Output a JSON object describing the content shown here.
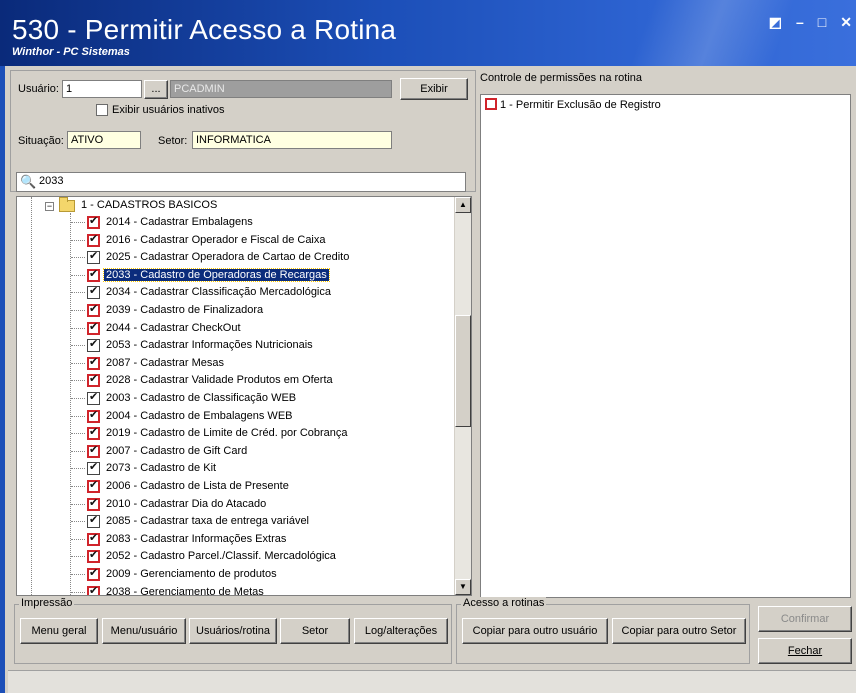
{
  "window": {
    "title": "530 - Permitir Acesso a Rotina",
    "subtitle": "Winthor - PC Sistemas",
    "controls": [
      "◩",
      "–",
      "□",
      "✕"
    ]
  },
  "user": {
    "usuario_label": "Usuário:",
    "usuario_value": "1",
    "lookup_button": "...",
    "user_name": "PCADMIN",
    "exibir_button": "Exibir",
    "inactive_checkbox_label": "Exibir usuários inativos",
    "situacao_label": "Situação:",
    "situacao_value": "ATIVO",
    "setor_label": "Setor:",
    "setor_value": "INFORMATICA"
  },
  "search": {
    "value": "2033",
    "icon": "search-icon"
  },
  "tree": {
    "category": "1 - CADASTROS BASICOS",
    "items": [
      {
        "label": "2014 - Cadastrar Embalagens",
        "red": true
      },
      {
        "label": "2016 - Cadastrar Operador e Fiscal de Caixa",
        "red": true
      },
      {
        "label": "2025 - Cadastrar Operadora de Cartao de Credito",
        "red": false
      },
      {
        "label": "2033 - Cadastro de Operadoras de Recargas",
        "red": true,
        "selected": true
      },
      {
        "label": "2034 - Cadastrar Classificação Mercadológica",
        "red": false
      },
      {
        "label": "2039 - Cadastro de Finalizadora",
        "red": true
      },
      {
        "label": "2044 - Cadastrar CheckOut",
        "red": true
      },
      {
        "label": "2053 - Cadastrar Informações Nutricionais",
        "red": false
      },
      {
        "label": "2087 - Cadastrar Mesas",
        "red": true
      },
      {
        "label": "2028 - Cadastrar Validade Produtos em Oferta",
        "red": true
      },
      {
        "label": "2003 - Cadastro de Classificação WEB",
        "red": false
      },
      {
        "label": "2004 - Cadastro de Embalagens WEB",
        "red": true
      },
      {
        "label": "2019 - Cadastro de Limite de Créd. por Cobrança",
        "red": true
      },
      {
        "label": "2007 - Cadastro de Gift Card",
        "red": true
      },
      {
        "label": "2073 - Cadastro de Kit",
        "red": false
      },
      {
        "label": "2006 - Cadastro de Lista de Presente",
        "red": true
      },
      {
        "label": "2010 - Cadastrar Dia do Atacado",
        "red": true
      },
      {
        "label": "2085 - Cadastrar taxa de entrega variável",
        "red": false
      },
      {
        "label": "2083 - Cadastrar Informações Extras",
        "red": true
      },
      {
        "label": "2052 - Cadastro Parcel./Classif. Mercadológica",
        "red": true
      },
      {
        "label": "2009 - Gerenciamento de produtos",
        "red": true
      },
      {
        "label": "2038 - Gerenciamento de Metas",
        "red": true
      }
    ]
  },
  "permissions": {
    "header": "Controle de permissões na rotina",
    "items": [
      "1 - Permitir Exclusão de Registro"
    ]
  },
  "impressao": {
    "title": "Impressão",
    "buttons": [
      "Menu geral",
      "Menu/usuário",
      "Usuários/rotina",
      "Setor",
      "Log/alterações"
    ]
  },
  "acesso": {
    "title": "Acesso a rotinas",
    "buttons": [
      "Copiar para outro usuário",
      "Copiar para outro Setor"
    ]
  },
  "actions": {
    "confirmar": "Confirmar",
    "fechar": "Fechar"
  },
  "colors": {
    "titlebar": "#1c4fb8",
    "check_red": "#d0242b",
    "selection": "#0b2c7c"
  }
}
